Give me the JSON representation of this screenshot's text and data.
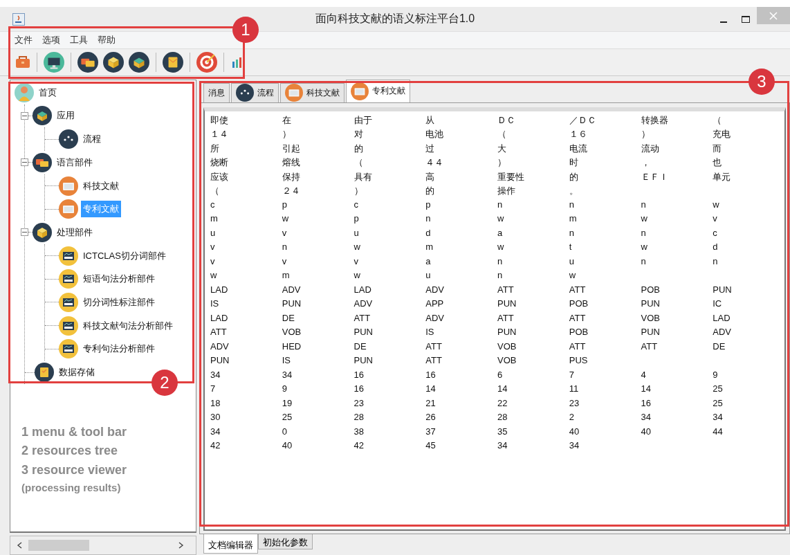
{
  "window": {
    "title": "面向科技文献的语义标注平台1.0"
  },
  "menu": [
    "文件",
    "选项",
    "工具",
    "帮助"
  ],
  "tree": {
    "root": {
      "label": "首页",
      "kind": "home",
      "selected": false
    },
    "items": [
      {
        "label": "应用",
        "kind": "app",
        "selected": false,
        "expanded": true,
        "children": [
          {
            "label": "流程",
            "kind": "flow",
            "selected": false
          }
        ]
      },
      {
        "label": "语言部件",
        "kind": "language",
        "selected": false,
        "expanded": true,
        "children": [
          {
            "label": "科技文献",
            "kind": "doc",
            "selected": false
          },
          {
            "label": "专利文献",
            "kind": "doc",
            "selected": true
          }
        ]
      },
      {
        "label": "处理部件",
        "kind": "processing",
        "selected": false,
        "expanded": true,
        "children": [
          {
            "label": "ICTCLAS切分词部件",
            "kind": "component",
            "selected": false
          },
          {
            "label": "短语句法分析部件",
            "kind": "component",
            "selected": false
          },
          {
            "label": "切分词性标注部件",
            "kind": "component",
            "selected": false
          },
          {
            "label": "科技文献句法分析部件",
            "kind": "component",
            "selected": false
          },
          {
            "label": "专利句法分析部件",
            "kind": "component",
            "selected": false
          }
        ]
      },
      {
        "label": "数据存储",
        "kind": "storage",
        "selected": false
      }
    ]
  },
  "legend": [
    "1 menu & tool bar",
    "2 resources tree",
    "3 resource viewer",
    "(processing results)"
  ],
  "tabs": [
    {
      "label": "消息",
      "kind": "text",
      "selected": false
    },
    {
      "label": "流程",
      "kind": "flow",
      "selected": false
    },
    {
      "label": "科技文献",
      "kind": "doc",
      "selected": false
    },
    {
      "label": "专利文献",
      "kind": "doc",
      "selected": true
    }
  ],
  "grid": {
    "rows": [
      [
        "即使",
        "在",
        "由于",
        "从",
        "ＤＣ",
        "／ＤＣ",
        "转换器",
        "（"
      ],
      [
        "１４",
        "）",
        "对",
        "电池",
        "（",
        "１６",
        "）",
        "充电"
      ],
      [
        "所",
        "引起",
        "的",
        "过",
        "大",
        "电流",
        "流动",
        "而"
      ],
      [
        "烧断",
        "熔线",
        "（",
        "４４",
        "）",
        "时",
        "，",
        "也"
      ],
      [
        "应该",
        "保持",
        "具有",
        "高",
        "重要性",
        "的",
        "ＥＦＩ",
        "单元"
      ],
      [
        "（",
        "２４",
        "）",
        "的",
        "操作",
        "。"
      ],
      [
        "c",
        "p",
        "c",
        "p",
        "n",
        "n",
        "n",
        "w"
      ],
      [
        "m",
        "w",
        "p",
        "n",
        "w",
        "m",
        "w",
        "v"
      ],
      [
        "u",
        "v",
        "u",
        "d",
        "a",
        "n",
        "n",
        "c"
      ],
      [
        "v",
        "n",
        "w",
        "m",
        "w",
        "t",
        "w",
        "d"
      ],
      [
        "v",
        "v",
        "v",
        "a",
        "n",
        "u",
        "n",
        "n"
      ],
      [
        "w",
        "m",
        "w",
        "u",
        "n",
        "w"
      ],
      [
        "LAD",
        "ADV",
        "LAD",
        "ADV",
        "ATT",
        "ATT",
        "POB",
        "PUN"
      ],
      [
        "IS",
        "PUN",
        "ADV",
        "APP",
        "PUN",
        "POB",
        "PUN",
        "IC"
      ],
      [
        "LAD",
        "DE",
        "ATT",
        "ADV",
        "ATT",
        "ATT",
        "VOB",
        "LAD"
      ],
      [
        "ATT",
        "VOB",
        "PUN",
        "IS",
        "PUN",
        "POB",
        "PUN",
        "ADV"
      ],
      [
        "ADV",
        "HED",
        "DE",
        "ATT",
        "VOB",
        "ATT",
        "ATT",
        "DE"
      ],
      [
        "PUN",
        "IS",
        "PUN",
        "ATT",
        "VOB",
        "PUS"
      ],
      [
        "34",
        "34",
        "16",
        "16",
        "6",
        "7",
        "4",
        "9"
      ],
      [
        "7",
        "9",
        "16",
        "14",
        "14",
        "11",
        "14",
        "25"
      ],
      [
        "18",
        "19",
        "23",
        "21",
        "22",
        "23",
        "16",
        "25"
      ],
      [
        "30",
        "25",
        "28",
        "26",
        "28",
        "2",
        "34",
        "34"
      ],
      [
        "34",
        "0",
        "38",
        "37",
        "35",
        "40",
        "40",
        "44"
      ],
      [
        "42",
        "40",
        "42",
        "45",
        "34",
        "34"
      ]
    ]
  },
  "bottom_tabs": [
    {
      "label": "文档编辑器",
      "selected": true
    },
    {
      "label": "初始化参数",
      "selected": false
    }
  ],
  "markers": [
    {
      "number": "1"
    },
    {
      "number": "2"
    },
    {
      "number": "3"
    }
  ]
}
